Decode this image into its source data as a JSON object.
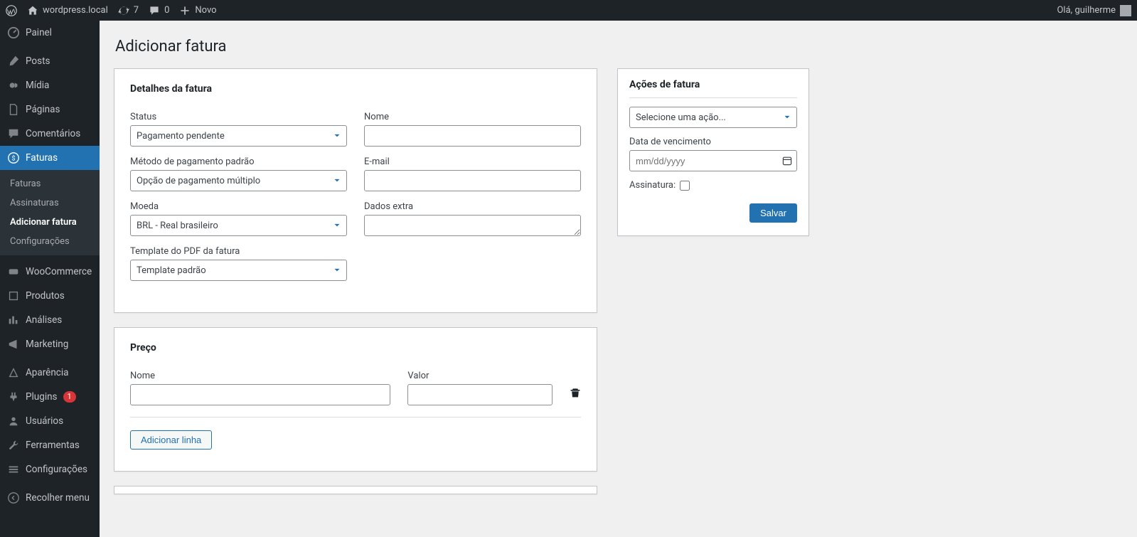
{
  "adminbar": {
    "site_name": "wordpress.local",
    "updates_count": "7",
    "comments_count": "0",
    "new_label": "Novo",
    "greeting": "Olá, guilherme"
  },
  "sidebar": {
    "items": [
      {
        "label": "Painel"
      },
      {
        "label": "Posts"
      },
      {
        "label": "Mídia"
      },
      {
        "label": "Páginas"
      },
      {
        "label": "Comentários"
      },
      {
        "label": "Faturas",
        "current": true
      },
      {
        "label": "WooCommerce"
      },
      {
        "label": "Produtos"
      },
      {
        "label": "Análises"
      },
      {
        "label": "Marketing"
      },
      {
        "label": "Aparência"
      },
      {
        "label": "Plugins",
        "badge": "1"
      },
      {
        "label": "Usuários"
      },
      {
        "label": "Ferramentas"
      },
      {
        "label": "Configurações"
      },
      {
        "label": "Recolher menu"
      }
    ],
    "submenu": [
      {
        "label": "Faturas"
      },
      {
        "label": "Assinaturas"
      },
      {
        "label": "Adicionar fatura",
        "current": true
      },
      {
        "label": "Configurações"
      }
    ]
  },
  "page": {
    "title": "Adicionar fatura"
  },
  "details": {
    "heading": "Detalhes da fatura",
    "status_label": "Status",
    "status_value": "Pagamento pendente",
    "name_label": "Nome",
    "name_value": "",
    "payment_method_label": "Método de pagamento padrão",
    "payment_method_value": "Opção de pagamento múltiplo",
    "email_label": "E-mail",
    "email_value": "",
    "currency_label": "Moeda",
    "currency_value": "BRL - Real brasileiro",
    "extra_label": "Dados extra",
    "extra_value": "",
    "template_label": "Template do PDF da fatura",
    "template_value": "Template padrão"
  },
  "price": {
    "heading": "Preço",
    "name_label": "Nome",
    "value_label": "Valor",
    "add_line": "Adicionar linha"
  },
  "actions": {
    "heading": "Ações de fatura",
    "select_placeholder": "Selecione uma ação...",
    "due_date_label": "Data de vencimento",
    "due_date_placeholder": "mm/dd/yyyy",
    "signature_label": "Assinatura:",
    "save": "Salvar"
  }
}
